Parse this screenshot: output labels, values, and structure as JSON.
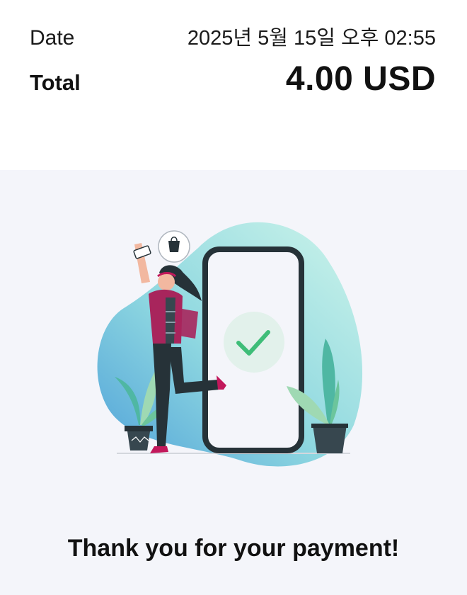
{
  "receipt": {
    "date_label": "Date",
    "date_value": "2025년 5월 15일 오후 02:55",
    "total_label": "Total",
    "total_value": "4.00 USD"
  },
  "confirmation": {
    "message": "Thank you for your payment!",
    "illustration_icon": "payment-success-illustration",
    "check_icon": "checkmark-icon"
  },
  "colors": {
    "panel_background": "#f4f5fa",
    "blob_gradient_start": "#5aa9dd",
    "blob_gradient_end": "#c9f3ea",
    "success_green": "#3ebd78",
    "phone_frame": "#263238",
    "accent_pink": "#a8255c"
  }
}
